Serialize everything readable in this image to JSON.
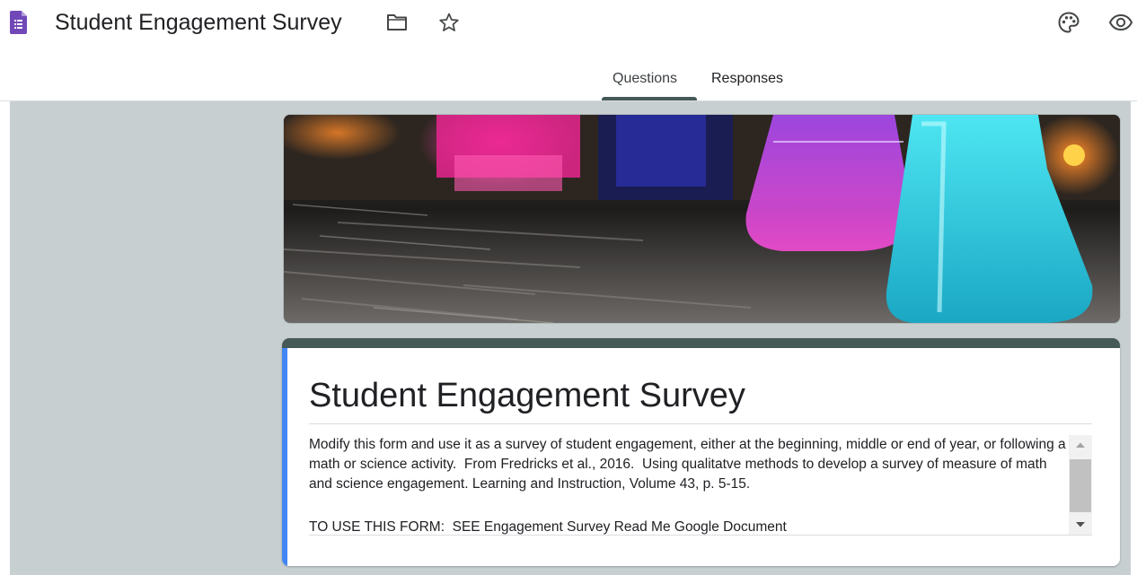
{
  "header": {
    "app_icon": "forms-icon",
    "title": "Student Engagement Survey",
    "folder_icon": "folder-icon",
    "star_icon": "star-icon",
    "palette_icon": "palette-icon",
    "preview_icon": "eye-icon"
  },
  "tabs": [
    {
      "label": "Questions",
      "active": true
    },
    {
      "label": "Responses",
      "active": false
    }
  ],
  "form": {
    "title": "Student Engagement Survey",
    "description_paragraph_1": "Modify this form and use it as a survey of student engagement, either at the beginning, middle or end of year, or following a math or science activity.  From Fredricks et al., 2016.  Using qualitatve methods to develop a survey of measure of math and science engagement. Learning and Instruction, Volume 43, p. 5-15.",
    "description_paragraph_2": "TO USE THIS FORM:  SEE Engagement Survey Read Me Google Document"
  },
  "colors": {
    "theme": "#455a57",
    "accent": "#4285f4",
    "background": "#c7cfd1",
    "forms_purple": "#7248b9"
  }
}
